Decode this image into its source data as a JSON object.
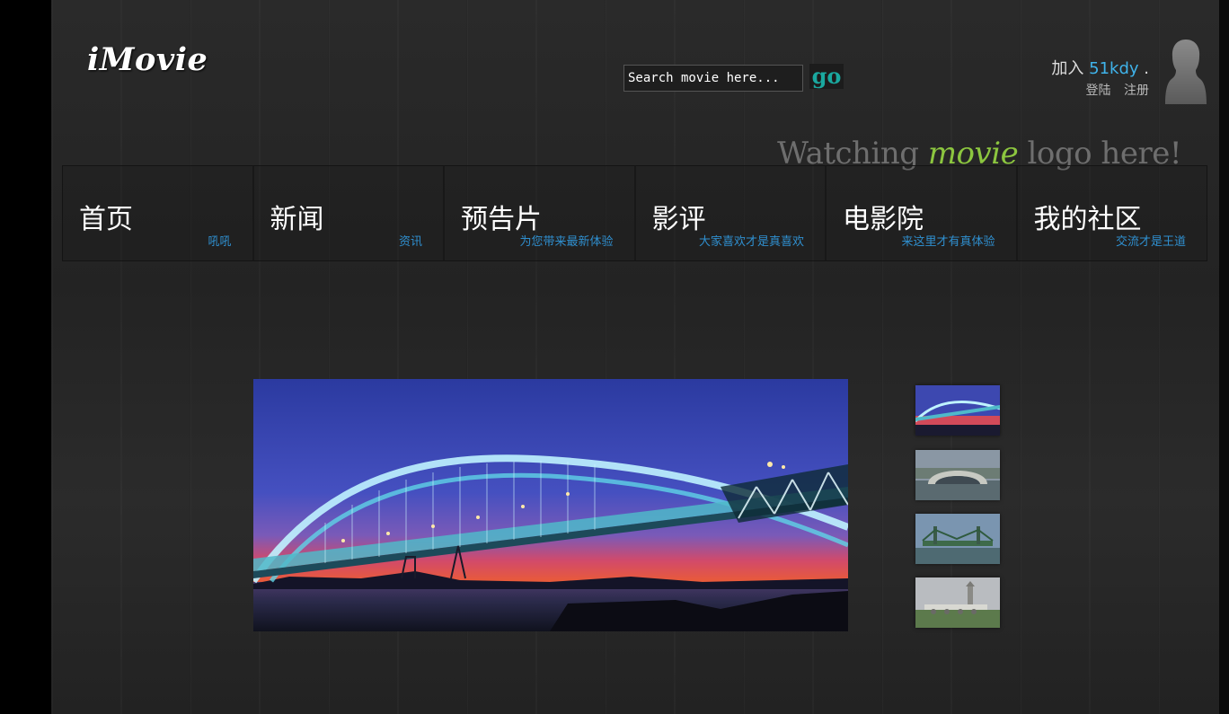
{
  "brand": {
    "logo": "iMovie"
  },
  "search": {
    "placeholder": "Search movie here...",
    "go_label": "go"
  },
  "account": {
    "join_prefix": "加入",
    "site_name": "51kdy",
    "join_suffix": ".",
    "login_label": "登陆",
    "register_label": "注册"
  },
  "tagline": {
    "before": "Watching",
    "highlight": "movie",
    "after": "logo here!"
  },
  "nav": {
    "items": [
      {
        "title": "首页",
        "sub": "吼吼"
      },
      {
        "title": "新闻",
        "sub": "资讯"
      },
      {
        "title": "预告片",
        "sub": "为您带来最新体验"
      },
      {
        "title": "影评",
        "sub": "大家喜欢才是真喜欢"
      },
      {
        "title": "电影院",
        "sub": "来这里才有真体验"
      },
      {
        "title": "我的社区",
        "sub": "交流才是王道"
      }
    ]
  },
  "slideshow": {
    "thumbnails": [
      "bridge-night-icon",
      "stone-arch-bridge-icon",
      "steel-truss-bridge-icon",
      "pagoda-bridge-icon"
    ]
  },
  "colors": {
    "accent_teal": "#1aa89f",
    "link_blue": "#2f8fcf",
    "highlight_green": "#8cc63f",
    "site_blue": "#3fb3ea"
  }
}
